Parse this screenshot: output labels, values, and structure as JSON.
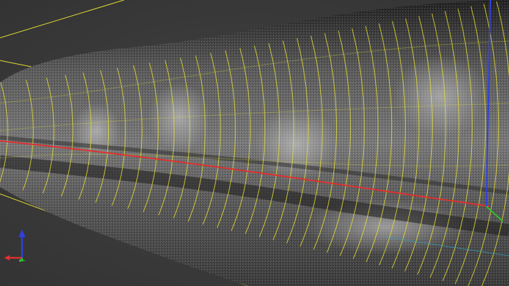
{
  "viewer": {
    "background_color": "#3b3b3b",
    "grid_color": "#e6e032",
    "pointcloud_color": "#8a8a8a",
    "axis_colors": {
      "x": "#e03030",
      "y": "#30c030",
      "z": "#3040e0"
    }
  },
  "widgets": {
    "orientation_gizmo": "xyz-axes-icon"
  }
}
